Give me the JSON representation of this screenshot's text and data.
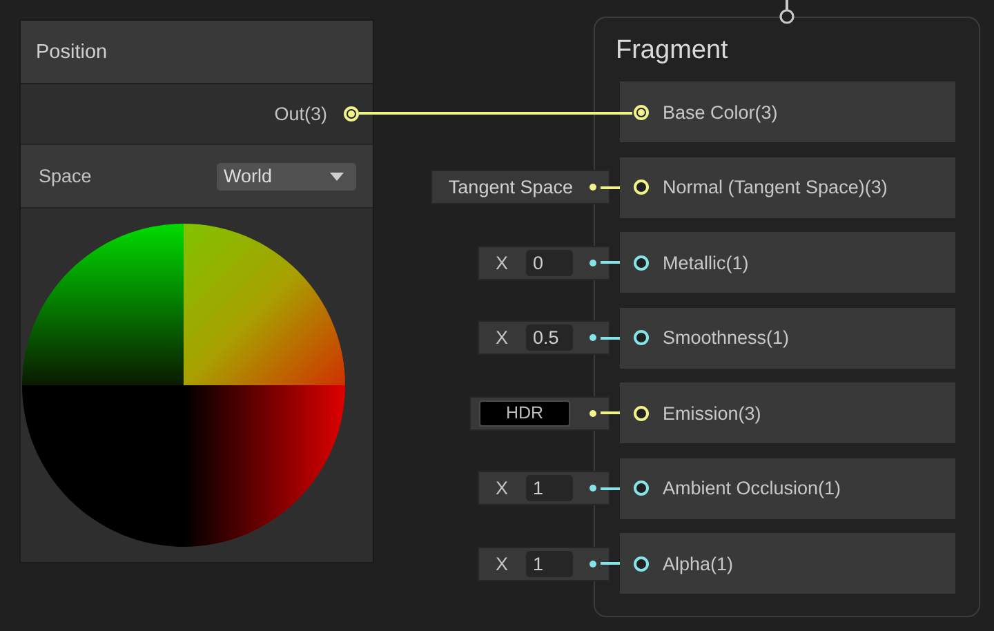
{
  "position_node": {
    "title": "Position",
    "output": {
      "label": "Out(3)",
      "color": "#f2f28c"
    },
    "space": {
      "label": "Space",
      "value": "World"
    }
  },
  "fragment_node": {
    "title": "Fragment",
    "slots": [
      {
        "label": "Base Color(3)",
        "color": "#f2f28c",
        "connected": true
      },
      {
        "label": "Normal (Tangent Space)(3)",
        "color": "#f2f28c",
        "connected": false,
        "input": {
          "kind": "text",
          "value": "Tangent Space"
        }
      },
      {
        "label": "Metallic(1)",
        "color": "#84e4e7",
        "connected": false,
        "input": {
          "kind": "float",
          "axis": "X",
          "value": "0"
        }
      },
      {
        "label": "Smoothness(1)",
        "color": "#84e4e7",
        "connected": false,
        "input": {
          "kind": "float",
          "axis": "X",
          "value": "0.5"
        }
      },
      {
        "label": "Emission(3)",
        "color": "#f2f28c",
        "connected": false,
        "input": {
          "kind": "hdr",
          "value": "HDR"
        }
      },
      {
        "label": "Ambient Occlusion(1)",
        "color": "#84e4e7",
        "connected": false,
        "input": {
          "kind": "float",
          "axis": "X",
          "value": "1"
        }
      },
      {
        "label": "Alpha(1)",
        "color": "#84e4e7",
        "connected": false,
        "input": {
          "kind": "float",
          "axis": "X",
          "value": "1"
        }
      }
    ]
  }
}
